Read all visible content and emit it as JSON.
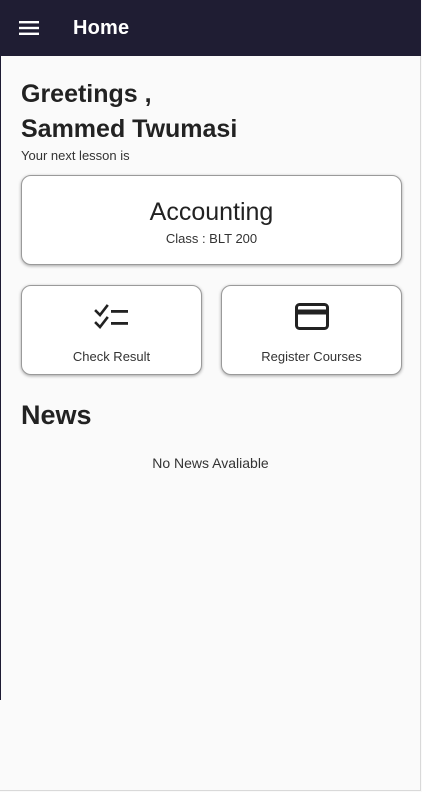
{
  "header": {
    "title": "Home",
    "menu_icon": "menu-icon"
  },
  "greeting": {
    "line1": "Greetings ,",
    "line2": "Sammed Twumasi",
    "subtitle": "Your next lesson is"
  },
  "next_lesson": {
    "course": "Accounting",
    "class_label": "Class : BLT 200"
  },
  "actions": [
    {
      "label": "Check Result",
      "icon": "checklist-icon"
    },
    {
      "label": "Register Courses",
      "icon": "credit-card-icon"
    }
  ],
  "news": {
    "heading": "News",
    "empty_text": "No News Avaliable"
  },
  "colors": {
    "appbar": "#1f1d33",
    "background": "#fafafa",
    "card": "#ffffff"
  }
}
